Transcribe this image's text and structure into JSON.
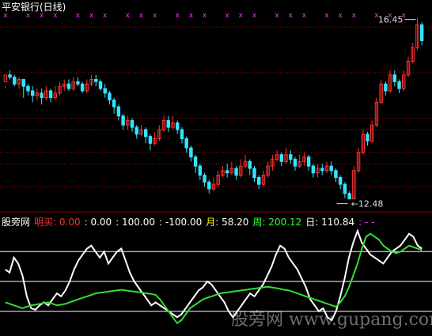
{
  "stock_title": "平安银行(日线)",
  "indicator_name": "股旁网",
  "indicator_values": [
    {
      "label": "明买",
      "value": "0.00",
      "label_color": "#ff3333",
      "value_color": "#ff3333"
    },
    {
      "label": "",
      "value": "0.00",
      "label_color": "#ffffff",
      "value_color": "#ffffff"
    },
    {
      "label": "",
      "value": "100.00",
      "label_color": "#ffffff",
      "value_color": "#ffffff"
    },
    {
      "label": "",
      "value": "-100.00",
      "label_color": "#ffffff",
      "value_color": "#ffffff"
    },
    {
      "label": "月",
      "value": "58.20",
      "label_color": "#ffff00",
      "value_color": "#ffffff"
    },
    {
      "label": "周",
      "value": "200.12",
      "label_color": "#33ff33",
      "value_color": "#33ff33"
    },
    {
      "label": "日",
      "value": "110.84",
      "label_color": "#ffffff",
      "value_color": "#ffffff"
    },
    {
      "label": "",
      "value": "- -",
      "label_color": "#ff33ff",
      "value_color": "#ff33ff"
    }
  ],
  "watermark_text": "股旁网 www.gupang.com",
  "colors": {
    "up": "#ff3333",
    "down": "#33e5ff",
    "grid": "#a00000",
    "marker": "#ff33ff",
    "annot": "#dddddd",
    "white": "#ffffff",
    "green": "#33dd33",
    "magenta": "#ff33ff",
    "red": "#ff2222"
  },
  "chart_data": [
    {
      "type": "candlestick",
      "title": "平安银行(日线)",
      "annotations": [
        {
          "text": "16.45",
          "kind": "high",
          "value": 16.45
        },
        {
          "text": "12.48",
          "kind": "low",
          "value": 12.48
        }
      ],
      "ylim": [
        12.3,
        16.6
      ],
      "top_markers": "x",
      "candles": [
        [
          15.05,
          15.2,
          14.95,
          14.9
        ],
        [
          15.2,
          15.15,
          15.3,
          15.1
        ],
        [
          15.15,
          15.0,
          15.2,
          14.95
        ],
        [
          15.0,
          15.1,
          15.15,
          14.9
        ],
        [
          15.1,
          14.95,
          15.1,
          14.7
        ],
        [
          14.95,
          14.85,
          15.0,
          14.75
        ],
        [
          14.85,
          14.75,
          14.95,
          14.6
        ],
        [
          14.75,
          14.8,
          14.9,
          14.65
        ],
        [
          14.8,
          14.7,
          14.9,
          14.55
        ],
        [
          14.7,
          14.85,
          14.95,
          14.65
        ],
        [
          14.85,
          14.7,
          14.9,
          14.6
        ],
        [
          14.7,
          14.8,
          14.95,
          14.65
        ],
        [
          14.8,
          14.95,
          15.05,
          14.75
        ],
        [
          14.95,
          15.0,
          15.1,
          14.85
        ],
        [
          15.0,
          14.9,
          15.1,
          14.85
        ],
        [
          14.9,
          15.05,
          15.15,
          14.85
        ],
        [
          15.05,
          15.0,
          15.15,
          14.95
        ],
        [
          15.0,
          14.85,
          15.05,
          14.8
        ],
        [
          14.85,
          15.0,
          15.1,
          14.8
        ],
        [
          15.0,
          15.1,
          15.2,
          14.95
        ],
        [
          15.1,
          15.05,
          15.2,
          14.95
        ],
        [
          15.05,
          14.9,
          15.1,
          14.85
        ],
        [
          14.9,
          14.8,
          15.0,
          14.7
        ],
        [
          14.8,
          14.65,
          14.85,
          14.55
        ],
        [
          14.65,
          14.5,
          14.7,
          14.35
        ],
        [
          14.5,
          14.3,
          14.55,
          14.2
        ],
        [
          14.3,
          14.1,
          14.35,
          14.0
        ],
        [
          14.1,
          14.2,
          14.3,
          14.0
        ],
        [
          14.2,
          14.05,
          14.25,
          13.95
        ],
        [
          14.05,
          13.9,
          14.1,
          13.8
        ],
        [
          13.9,
          14.0,
          14.1,
          13.85
        ],
        [
          14.0,
          13.85,
          14.05,
          13.7
        ],
        [
          13.85,
          13.7,
          13.9,
          13.55
        ],
        [
          13.7,
          13.8,
          13.95,
          13.65
        ],
        [
          13.8,
          14.0,
          14.1,
          13.75
        ],
        [
          14.0,
          14.2,
          14.3,
          13.95
        ],
        [
          14.2,
          14.05,
          14.3,
          13.95
        ],
        [
          14.05,
          14.15,
          14.3,
          14.0
        ],
        [
          14.15,
          14.0,
          14.2,
          13.9
        ],
        [
          14.0,
          13.8,
          14.05,
          13.7
        ],
        [
          13.8,
          13.6,
          13.85,
          13.5
        ],
        [
          13.6,
          13.4,
          13.65,
          13.3
        ],
        [
          13.4,
          13.2,
          13.45,
          13.05
        ],
        [
          13.2,
          13.0,
          13.25,
          12.9
        ],
        [
          13.0,
          12.85,
          13.05,
          12.75
        ],
        [
          12.85,
          12.7,
          12.9,
          12.6
        ],
        [
          12.7,
          12.8,
          12.95,
          12.65
        ],
        [
          12.8,
          13.0,
          13.1,
          12.75
        ],
        [
          13.0,
          13.1,
          13.2,
          12.95
        ],
        [
          13.1,
          13.05,
          13.25,
          12.95
        ],
        [
          13.05,
          13.15,
          13.3,
          13.0
        ],
        [
          13.15,
          13.0,
          13.2,
          12.9
        ],
        [
          13.0,
          13.2,
          13.35,
          12.95
        ],
        [
          13.2,
          13.3,
          13.45,
          13.15
        ],
        [
          13.3,
          13.15,
          13.35,
          13.0
        ],
        [
          13.15,
          12.95,
          13.2,
          12.85
        ],
        [
          12.95,
          12.8,
          13.0,
          12.7
        ],
        [
          12.8,
          13.0,
          13.1,
          12.75
        ],
        [
          13.0,
          13.2,
          13.3,
          12.95
        ],
        [
          13.2,
          13.35,
          13.45,
          13.1
        ],
        [
          13.35,
          13.45,
          13.55,
          13.3
        ],
        [
          13.45,
          13.3,
          13.5,
          13.2
        ],
        [
          13.3,
          13.45,
          13.6,
          13.25
        ],
        [
          13.45,
          13.35,
          13.55,
          13.25
        ],
        [
          13.35,
          13.2,
          13.4,
          13.1
        ],
        [
          13.2,
          13.3,
          13.45,
          13.15
        ],
        [
          13.3,
          13.4,
          13.5,
          13.2
        ],
        [
          13.4,
          13.2,
          13.45,
          13.1
        ],
        [
          13.2,
          13.05,
          13.25,
          12.95
        ],
        [
          13.05,
          13.15,
          13.25,
          12.95
        ],
        [
          13.15,
          13.1,
          13.25,
          13.0
        ],
        [
          13.1,
          13.2,
          13.3,
          13.05
        ],
        [
          13.2,
          13.1,
          13.3,
          13.0
        ],
        [
          13.1,
          12.95,
          13.15,
          12.85
        ],
        [
          12.95,
          12.8,
          13.0,
          12.7
        ],
        [
          12.8,
          12.6,
          12.85,
          12.5
        ],
        [
          12.6,
          12.48,
          12.65,
          12.48
        ],
        [
          12.48,
          13.1,
          13.2,
          12.48
        ],
        [
          13.1,
          13.5,
          13.6,
          13.05
        ],
        [
          13.5,
          13.9,
          14.0,
          13.45
        ],
        [
          13.9,
          13.75,
          13.95,
          13.65
        ],
        [
          13.75,
          14.1,
          14.2,
          13.7
        ],
        [
          14.1,
          14.6,
          14.7,
          14.05
        ],
        [
          14.6,
          15.0,
          15.1,
          14.55
        ],
        [
          15.0,
          14.85,
          15.05,
          14.75
        ],
        [
          14.85,
          15.2,
          15.3,
          14.8
        ],
        [
          15.2,
          15.05,
          15.3,
          14.95
        ],
        [
          15.05,
          14.9,
          15.1,
          14.8
        ],
        [
          14.9,
          15.2,
          15.3,
          14.85
        ],
        [
          15.2,
          15.5,
          15.6,
          15.15
        ],
        [
          15.5,
          15.8,
          15.9,
          15.45
        ],
        [
          15.8,
          16.3,
          16.45,
          15.75
        ],
        [
          16.3,
          15.95,
          16.35,
          15.85
        ]
      ]
    },
    {
      "type": "line",
      "title": "股旁网",
      "ylim": [
        -175,
        175
      ],
      "levels": [
        100,
        0,
        -100
      ],
      "series": [
        {
          "name": "日",
          "color": "#ffffff",
          "values": [
            40,
            30,
            80,
            60,
            20,
            -50,
            -90,
            -95,
            -80,
            -70,
            -80,
            -60,
            -40,
            -50,
            -30,
            0,
            40,
            70,
            90,
            110,
            120,
            100,
            80,
            100,
            60,
            80,
            100,
            110,
            70,
            30,
            0,
            -20,
            -40,
            -60,
            -80,
            -70,
            -80,
            -90,
            -100,
            -110,
            -120,
            -110,
            -90,
            -70,
            -50,
            -30,
            -20,
            0,
            -10,
            -30,
            -50,
            -70,
            -100,
            -120,
            -100,
            -80,
            -60,
            -40,
            -50,
            -30,
            -10,
            20,
            50,
            90,
            120,
            110,
            80,
            60,
            40,
            10,
            -20,
            -60,
            -80,
            -100,
            -90,
            -120,
            -130,
            -100,
            -50,
            10,
            80,
            130,
            170,
            130,
            110,
            90,
            80,
            70,
            60,
            80,
            100,
            110,
            120,
            140,
            160,
            150,
            120,
            110
          ]
        },
        {
          "name": "月",
          "color": "#ff33ff",
          "values": [
            null,
            null,
            null,
            null,
            null,
            null,
            null,
            null,
            null,
            null,
            null,
            null,
            null,
            null,
            null,
            null,
            null,
            null,
            null,
            null,
            null,
            null,
            null,
            null,
            null,
            null,
            null,
            null,
            null,
            null,
            null,
            null,
            null,
            null,
            null,
            null,
            null,
            null,
            null,
            null,
            null,
            null,
            null,
            null,
            null,
            null,
            null,
            null,
            null,
            null,
            null,
            null,
            null,
            null,
            null,
            null,
            null,
            null,
            null,
            null,
            null,
            null,
            null,
            null,
            null,
            null,
            null,
            null,
            null,
            null,
            null,
            null,
            null,
            null,
            null,
            null,
            null,
            null,
            null,
            null,
            null,
            null,
            null,
            null,
            null,
            null,
            null,
            null,
            null,
            null,
            null,
            null,
            null,
            null,
            null,
            null,
            null
          ]
        },
        {
          "name": "周",
          "color": "#33dd33",
          "values": [
            -70,
            -75,
            -80,
            -85,
            -90,
            -85,
            -80,
            -78,
            -75,
            -72,
            -70,
            -75,
            -80,
            -78,
            -75,
            -70,
            -65,
            -60,
            -55,
            -50,
            -45,
            -40,
            -38,
            -36,
            -34,
            -32,
            -30,
            -28,
            -30,
            -32,
            -34,
            -36,
            -38,
            -40,
            -42,
            -45,
            -60,
            -80,
            -100,
            -120,
            -140,
            -130,
            -110,
            -90,
            -80,
            -70,
            -60,
            -55,
            -50,
            -45,
            -40,
            -38,
            -36,
            -34,
            -32,
            -30,
            -28,
            -26,
            -24,
            -22,
            -20,
            -18,
            -20,
            -22,
            -25,
            -28,
            -30,
            -35,
            -40,
            -45,
            -50,
            -55,
            -60,
            -65,
            -70,
            -75,
            -80,
            -85,
            -70,
            -50,
            -20,
            20,
            60,
            110,
            150,
            160,
            150,
            140,
            120,
            110,
            100,
            95,
            100,
            110,
            120,
            115,
            110,
            105
          ]
        }
      ]
    }
  ]
}
